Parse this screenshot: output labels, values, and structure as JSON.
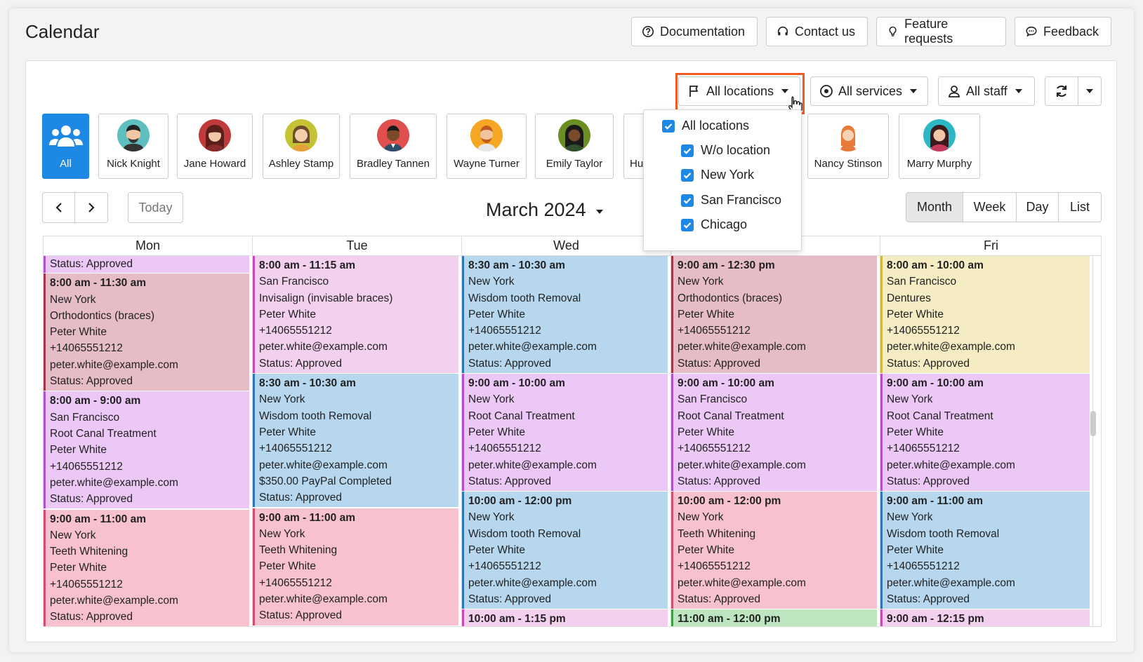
{
  "page": {
    "title": "Calendar"
  },
  "top_buttons": {
    "documentation": "Documentation",
    "contact": "Contact us",
    "features": "Feature requests",
    "feedback": "Feedback"
  },
  "filters": {
    "locations": "All locations",
    "services": "All services",
    "staff": "All staff"
  },
  "staff": [
    {
      "name": "All",
      "color": "#1e88e5"
    },
    {
      "name": "Nick Knight",
      "color": "#5fbfbf"
    },
    {
      "name": "Jane Howard",
      "color": "#c0393b"
    },
    {
      "name": "Ashley Stamp",
      "color": "#c6c235"
    },
    {
      "name": "Bradley Tannen",
      "color": "#e04e4e"
    },
    {
      "name": "Wayne Turner",
      "color": "#f5a623"
    },
    {
      "name": "Emily Taylor",
      "color": "#6b8e23"
    },
    {
      "name": "Hu",
      "color": "#999999"
    },
    {
      "name": "Nancy Stinson",
      "color": "#ffffff"
    },
    {
      "name": "Marry Murphy",
      "color": "#2bb8c4"
    }
  ],
  "nav": {
    "today": "Today",
    "month_title": "March 2024"
  },
  "views": {
    "month": "Month",
    "week": "Week",
    "day": "Day",
    "list": "List"
  },
  "days": [
    "Mon",
    "Tue",
    "Wed",
    "",
    "Fri"
  ],
  "location_dropdown": [
    "All locations",
    "W/o location",
    "New York",
    "San Francisco",
    "Chicago"
  ],
  "events": {
    "mon": [
      {
        "lines": [
          "",
          "Status: Approved"
        ],
        "color": "#ecc8f7",
        "border": "#b04fcf",
        "partial": true
      },
      {
        "lines": [
          "8:00 am - 11:30 am",
          "New York",
          "Orthodontics (braces)",
          "Peter White",
          "+14065551212",
          "peter.white@example.com",
          "Status: Approved"
        ],
        "color": "#e6bcc7",
        "border": "#a33449"
      },
      {
        "lines": [
          "8:00 am - 9:00 am",
          "San Francisco",
          "Root Canal Treatment",
          "Peter White",
          "+14065551212",
          "peter.white@example.com",
          "Status: Approved"
        ],
        "color": "#ecc8f7",
        "border": "#b04fcf"
      },
      {
        "lines": [
          "9:00 am - 11:00 am",
          "New York",
          "Teeth Whitening",
          "Peter White",
          "+14065551212",
          "peter.white@example.com",
          "Status: Approved"
        ],
        "color": "#f7c1cf",
        "border": "#d44d6c"
      }
    ],
    "tue": [
      {
        "lines": [
          "8:00 am - 11:15 am",
          "San Francisco",
          "Invisalign (invisable braces)",
          "Peter White",
          "+14065551212",
          "peter.white@example.com",
          "Status: Approved"
        ],
        "color": "#f4d0ef",
        "border": "#c74ab8"
      },
      {
        "lines": [
          "8:30 am - 10:30 am",
          "New York",
          "Wisdom tooth Removal",
          "Peter White",
          "+14065551212",
          "peter.white@example.com",
          "$350.00 PayPal Completed",
          "Status: Approved"
        ],
        "color": "#b6d7ee",
        "border": "#2e76b3"
      },
      {
        "lines": [
          "9:00 am - 11:00 am",
          "New York",
          "Teeth Whitening",
          "Peter White",
          "+14065551212",
          "peter.white@example.com",
          "Status: Approved"
        ],
        "color": "#f7c1cf",
        "border": "#d44d6c"
      }
    ],
    "wed": [
      {
        "lines": [
          "8:30 am - 10:30 am",
          "New York",
          "Wisdom tooth Removal",
          "Peter White",
          "+14065551212",
          "peter.white@example.com",
          "Status: Approved"
        ],
        "color": "#b6d7ee",
        "border": "#2e76b3"
      },
      {
        "lines": [
          "9:00 am - 10:00 am",
          "New York",
          "Root Canal Treatment",
          "Peter White",
          "+14065551212",
          "peter.white@example.com",
          "Status: Approved"
        ],
        "color": "#ecc8f7",
        "border": "#b04fcf"
      },
      {
        "lines": [
          "10:00 am - 12:00 pm",
          "New York",
          "Wisdom tooth Removal",
          "Peter White",
          "+14065551212",
          "peter.white@example.com",
          "Status: Approved"
        ],
        "color": "#b6d7ee",
        "border": "#2e76b3"
      },
      {
        "lines": [
          "10:00 am - 1:15 pm"
        ],
        "color": "#f4d0ef",
        "border": "#c74ab8"
      }
    ],
    "thu": [
      {
        "lines": [
          "9:00 am - 12:30 pm",
          "New York",
          "Orthodontics (braces)",
          "Peter White",
          "+14065551212",
          "peter.white@example.com",
          "Status: Approved"
        ],
        "color": "#e6bcc7",
        "border": "#a33449"
      },
      {
        "lines": [
          "9:00 am - 10:00 am",
          "San Francisco",
          "Root Canal Treatment",
          "Peter White",
          "+14065551212",
          "peter.white@example.com",
          "Status: Approved"
        ],
        "color": "#ecc8f7",
        "border": "#b04fcf"
      },
      {
        "lines": [
          "10:00 am - 12:00 pm",
          "New York",
          "Teeth Whitening",
          "Peter White",
          "+14065551212",
          "peter.white@example.com",
          "Status: Approved"
        ],
        "color": "#f7c1cf",
        "border": "#d44d6c"
      },
      {
        "lines": [
          "11:00 am - 12:00 pm"
        ],
        "color": "#bde5bf",
        "border": "#3f9f45"
      }
    ],
    "fri": [
      {
        "lines": [
          "8:00 am - 10:00 am",
          "San Francisco",
          "Dentures",
          "Peter White",
          "+14065551212",
          "peter.white@example.com",
          "Status: Approved"
        ],
        "color": "#f5ecc3",
        "border": "#d4b83a"
      },
      {
        "lines": [
          "9:00 am - 10:00 am",
          "New York",
          "Root Canal Treatment",
          "Peter White",
          "+14065551212",
          "peter.white@example.com",
          "Status: Approved"
        ],
        "color": "#ecc8f7",
        "border": "#b04fcf"
      },
      {
        "lines": [
          "9:00 am - 11:00 am",
          "New York",
          "Wisdom tooth Removal",
          "Peter White",
          "+14065551212",
          "peter.white@example.com",
          "Status: Approved"
        ],
        "color": "#b6d7ee",
        "border": "#2e76b3"
      },
      {
        "lines": [
          "9:00 am - 12:15 pm"
        ],
        "color": "#f4d0ef",
        "border": "#c74ab8"
      }
    ]
  }
}
